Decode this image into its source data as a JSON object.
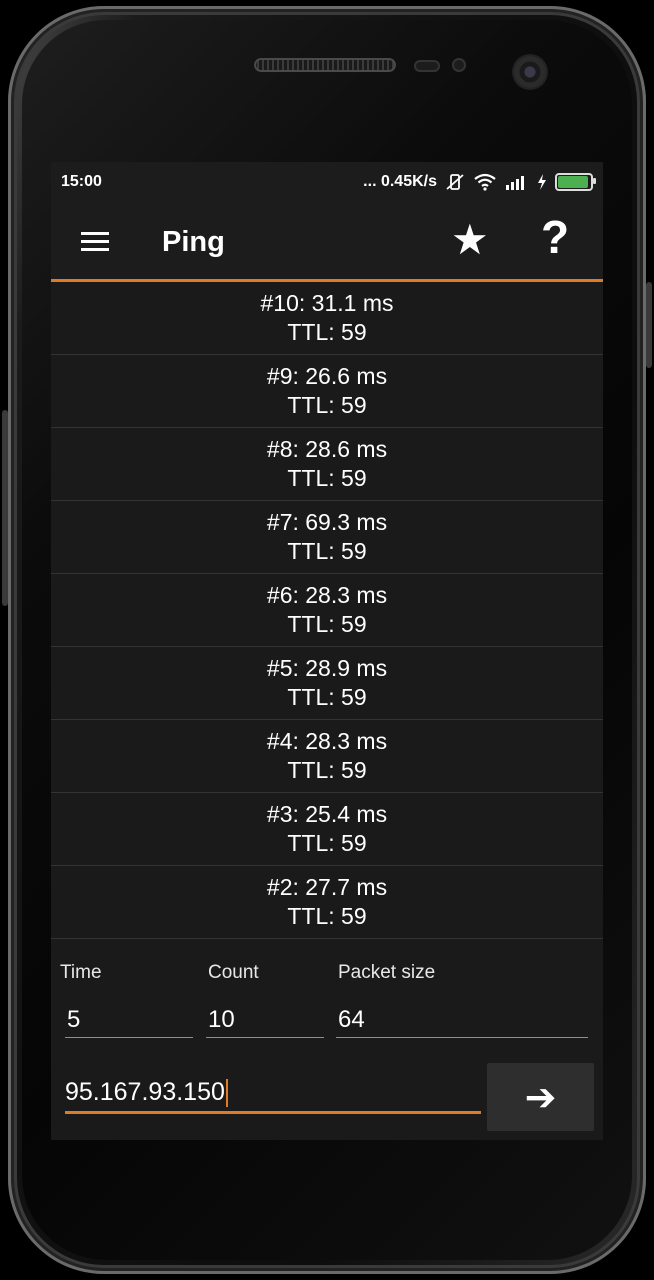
{
  "status_bar": {
    "time": "15:00",
    "network_speed": "... 0.45K/s"
  },
  "app_bar": {
    "title": "Ping",
    "star_glyph": "★",
    "help_glyph": "?"
  },
  "results": [
    {
      "line1": "#10: 31.1 ms",
      "line2": "TTL: 59"
    },
    {
      "line1": "#9: 26.6 ms",
      "line2": "TTL: 59"
    },
    {
      "line1": "#8: 28.6 ms",
      "line2": "TTL: 59"
    },
    {
      "line1": "#7: 69.3 ms",
      "line2": "TTL: 59"
    },
    {
      "line1": "#6: 28.3 ms",
      "line2": "TTL: 59"
    },
    {
      "line1": "#5: 28.9 ms",
      "line2": "TTL: 59"
    },
    {
      "line1": "#4: 28.3 ms",
      "line2": "TTL: 59"
    },
    {
      "line1": "#3: 25.4 ms",
      "line2": "TTL: 59"
    },
    {
      "line1": "#2: 27.7 ms",
      "line2": "TTL: 59"
    }
  ],
  "params": {
    "time": {
      "label": "Time",
      "value": "5"
    },
    "count": {
      "label": "Count",
      "value": "10"
    },
    "packet_size": {
      "label": "Packet size",
      "value": "64"
    }
  },
  "host": {
    "value": "95.167.93.150"
  },
  "go_button": {
    "glyph": "➔"
  },
  "colors": {
    "accent": "#e07a26",
    "background": "#1a1a1a",
    "battery": "#4caf50"
  }
}
